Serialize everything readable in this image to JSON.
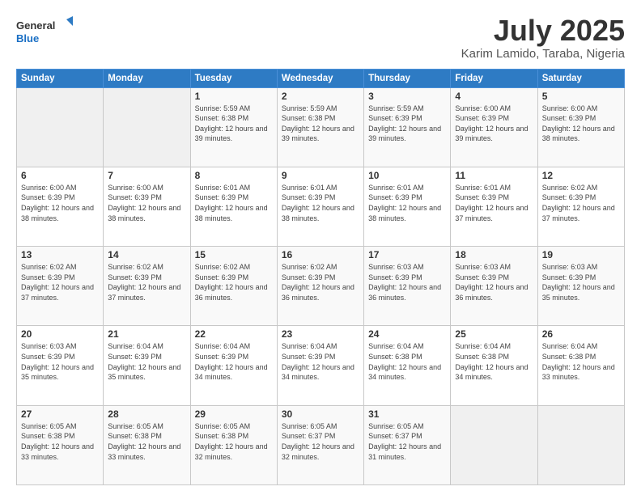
{
  "logo": {
    "line1": "General",
    "line2": "Blue"
  },
  "header": {
    "title": "July 2025",
    "subtitle": "Karim Lamido, Taraba, Nigeria"
  },
  "weekdays": [
    "Sunday",
    "Monday",
    "Tuesday",
    "Wednesday",
    "Thursday",
    "Friday",
    "Saturday"
  ],
  "weeks": [
    [
      {
        "day": "",
        "info": ""
      },
      {
        "day": "",
        "info": ""
      },
      {
        "day": "1",
        "info": "Sunrise: 5:59 AM\nSunset: 6:38 PM\nDaylight: 12 hours and 39 minutes."
      },
      {
        "day": "2",
        "info": "Sunrise: 5:59 AM\nSunset: 6:38 PM\nDaylight: 12 hours and 39 minutes."
      },
      {
        "day": "3",
        "info": "Sunrise: 5:59 AM\nSunset: 6:39 PM\nDaylight: 12 hours and 39 minutes."
      },
      {
        "day": "4",
        "info": "Sunrise: 6:00 AM\nSunset: 6:39 PM\nDaylight: 12 hours and 39 minutes."
      },
      {
        "day": "5",
        "info": "Sunrise: 6:00 AM\nSunset: 6:39 PM\nDaylight: 12 hours and 38 minutes."
      }
    ],
    [
      {
        "day": "6",
        "info": "Sunrise: 6:00 AM\nSunset: 6:39 PM\nDaylight: 12 hours and 38 minutes."
      },
      {
        "day": "7",
        "info": "Sunrise: 6:00 AM\nSunset: 6:39 PM\nDaylight: 12 hours and 38 minutes."
      },
      {
        "day": "8",
        "info": "Sunrise: 6:01 AM\nSunset: 6:39 PM\nDaylight: 12 hours and 38 minutes."
      },
      {
        "day": "9",
        "info": "Sunrise: 6:01 AM\nSunset: 6:39 PM\nDaylight: 12 hours and 38 minutes."
      },
      {
        "day": "10",
        "info": "Sunrise: 6:01 AM\nSunset: 6:39 PM\nDaylight: 12 hours and 38 minutes."
      },
      {
        "day": "11",
        "info": "Sunrise: 6:01 AM\nSunset: 6:39 PM\nDaylight: 12 hours and 37 minutes."
      },
      {
        "day": "12",
        "info": "Sunrise: 6:02 AM\nSunset: 6:39 PM\nDaylight: 12 hours and 37 minutes."
      }
    ],
    [
      {
        "day": "13",
        "info": "Sunrise: 6:02 AM\nSunset: 6:39 PM\nDaylight: 12 hours and 37 minutes."
      },
      {
        "day": "14",
        "info": "Sunrise: 6:02 AM\nSunset: 6:39 PM\nDaylight: 12 hours and 37 minutes."
      },
      {
        "day": "15",
        "info": "Sunrise: 6:02 AM\nSunset: 6:39 PM\nDaylight: 12 hours and 36 minutes."
      },
      {
        "day": "16",
        "info": "Sunrise: 6:02 AM\nSunset: 6:39 PM\nDaylight: 12 hours and 36 minutes."
      },
      {
        "day": "17",
        "info": "Sunrise: 6:03 AM\nSunset: 6:39 PM\nDaylight: 12 hours and 36 minutes."
      },
      {
        "day": "18",
        "info": "Sunrise: 6:03 AM\nSunset: 6:39 PM\nDaylight: 12 hours and 36 minutes."
      },
      {
        "day": "19",
        "info": "Sunrise: 6:03 AM\nSunset: 6:39 PM\nDaylight: 12 hours and 35 minutes."
      }
    ],
    [
      {
        "day": "20",
        "info": "Sunrise: 6:03 AM\nSunset: 6:39 PM\nDaylight: 12 hours and 35 minutes."
      },
      {
        "day": "21",
        "info": "Sunrise: 6:04 AM\nSunset: 6:39 PM\nDaylight: 12 hours and 35 minutes."
      },
      {
        "day": "22",
        "info": "Sunrise: 6:04 AM\nSunset: 6:39 PM\nDaylight: 12 hours and 34 minutes."
      },
      {
        "day": "23",
        "info": "Sunrise: 6:04 AM\nSunset: 6:39 PM\nDaylight: 12 hours and 34 minutes."
      },
      {
        "day": "24",
        "info": "Sunrise: 6:04 AM\nSunset: 6:38 PM\nDaylight: 12 hours and 34 minutes."
      },
      {
        "day": "25",
        "info": "Sunrise: 6:04 AM\nSunset: 6:38 PM\nDaylight: 12 hours and 34 minutes."
      },
      {
        "day": "26",
        "info": "Sunrise: 6:04 AM\nSunset: 6:38 PM\nDaylight: 12 hours and 33 minutes."
      }
    ],
    [
      {
        "day": "27",
        "info": "Sunrise: 6:05 AM\nSunset: 6:38 PM\nDaylight: 12 hours and 33 minutes."
      },
      {
        "day": "28",
        "info": "Sunrise: 6:05 AM\nSunset: 6:38 PM\nDaylight: 12 hours and 33 minutes."
      },
      {
        "day": "29",
        "info": "Sunrise: 6:05 AM\nSunset: 6:38 PM\nDaylight: 12 hours and 32 minutes."
      },
      {
        "day": "30",
        "info": "Sunrise: 6:05 AM\nSunset: 6:37 PM\nDaylight: 12 hours and 32 minutes."
      },
      {
        "day": "31",
        "info": "Sunrise: 6:05 AM\nSunset: 6:37 PM\nDaylight: 12 hours and 31 minutes."
      },
      {
        "day": "",
        "info": ""
      },
      {
        "day": "",
        "info": ""
      }
    ]
  ]
}
